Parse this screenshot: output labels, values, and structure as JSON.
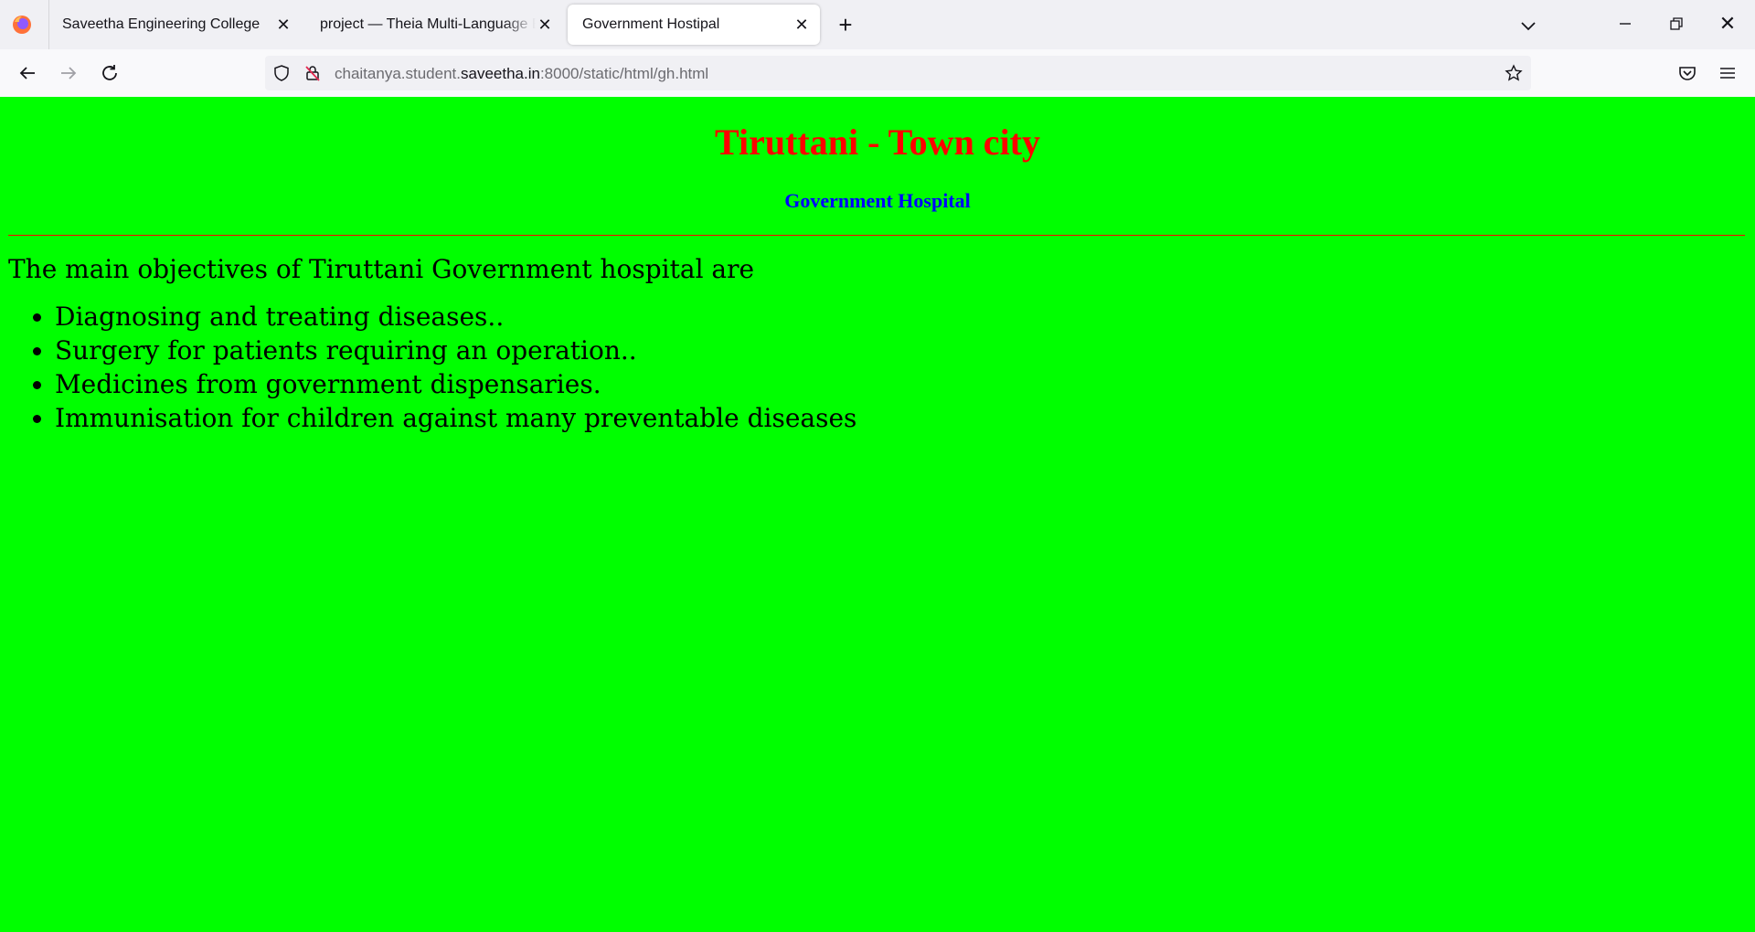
{
  "browser": {
    "tabs": [
      {
        "label": "Saveetha Engineering College",
        "active": false
      },
      {
        "label": "project — Theia Multi-Language Explorer",
        "active": false
      },
      {
        "label": "Government Hostipal",
        "active": true
      }
    ],
    "url": {
      "prefix": "chaitanya.student.",
      "host": "saveetha.in",
      "suffix": ":8000/static/html/gh.html"
    },
    "icons": [
      "firefox-logo-icon",
      "close-icon",
      "plus-icon",
      "chevron-down-icon",
      "minimize-icon",
      "restore-icon",
      "back-icon",
      "forward-icon",
      "reload-icon",
      "shield-icon",
      "insecure-lock-icon",
      "star-icon",
      "pocket-icon",
      "menu-icon"
    ]
  },
  "page": {
    "background": "#00ff00",
    "title": "Tiruttani - Town city",
    "title_color": "#ff0000",
    "subtitle": "Government Hospital",
    "subtitle_color": "#0000ff",
    "intro": "The main objectives of Tiruttani Government hospital are",
    "objectives": [
      "Diagnosing and treating diseases..",
      "Surgery for patients requiring an operation..",
      "Medicines from government dispensaries.",
      "Immunisation for children against many preventable diseases"
    ]
  }
}
